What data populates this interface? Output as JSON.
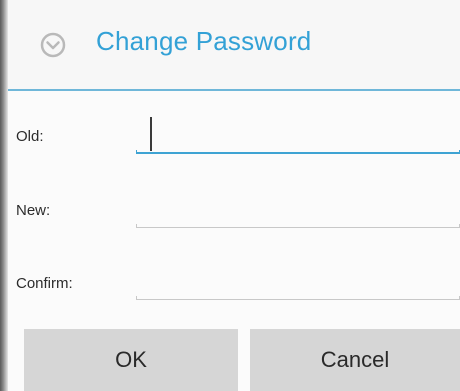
{
  "dialog": {
    "title": "Change Password",
    "title_icon": "chevron-down-circle-icon",
    "accent_color": "#33a1d6"
  },
  "fields": [
    {
      "label": "Old:",
      "value": "",
      "focused": true
    },
    {
      "label": "New:",
      "value": "",
      "focused": false
    },
    {
      "label": "Confirm:",
      "value": "",
      "focused": false
    }
  ],
  "buttons": {
    "ok_label": "OK",
    "cancel_label": "Cancel"
  }
}
